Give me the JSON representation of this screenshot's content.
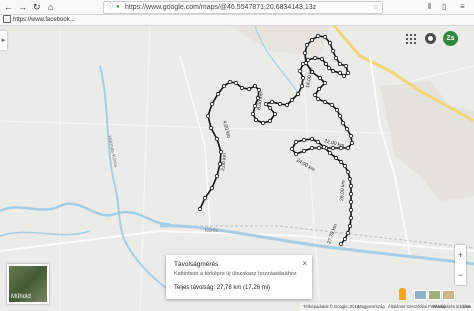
{
  "browser": {
    "url": "https://www.google.com/maps/@46.5547871,20.6834143,13z",
    "bookmark_label": "https://www.facebook..."
  },
  "map": {
    "distance_labels": [
      "2,00 km",
      "4,00 km",
      "6,00 km",
      "8,00 km",
      "10,00 km",
      "12,00 km",
      "14,00 km",
      "16,00 km",
      "18,00 km",
      "20,00 km",
      "22,00 km",
      "24,00 km",
      "26,00 km",
      "27,78 km"
    ],
    "avatar_initials": "Zs",
    "satellite_label": "Műhold",
    "place_labels": [
      "Hármas-Körös",
      "Kőrös"
    ]
  },
  "measure": {
    "title": "Távolságmérés",
    "hint": "Kattintson a térképre új útszakasz hozzáadásához",
    "total": "Teljes távolság: 27,78 km (17,26 mi)"
  },
  "footer": {
    "copyright": "Térképadatok © Google, 2018",
    "country": "Magyarország",
    "terms": "Általános Szerződési Feltételek",
    "feedback": "Visszajelzés küldése",
    "scale": "1 km"
  },
  "colors": {
    "accent": "#2b8a3e",
    "water": "#a7cfe3",
    "route": "#111111"
  }
}
